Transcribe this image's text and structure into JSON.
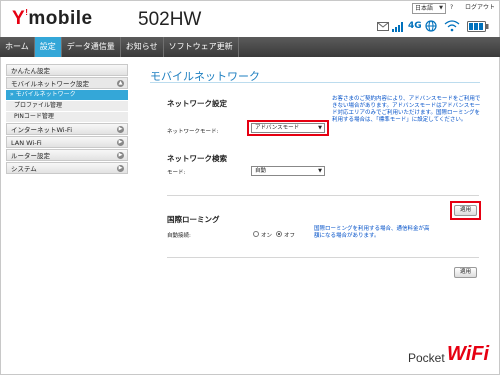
{
  "header": {
    "brand_prefix": "Y",
    "brand_mark": "!",
    "brand_name": "mobile",
    "model": "502HW",
    "language": "日本語",
    "help_label": "?",
    "logout_label": "ログアウト",
    "network_type": "4G",
    "icons": [
      "sms-icon",
      "signal-icon",
      "globe-icon",
      "wifi-status-icon",
      "battery-icon"
    ]
  },
  "nav": [
    {
      "label": "ホーム",
      "active": false
    },
    {
      "label": "設定",
      "active": true
    },
    {
      "label": "データ通信量",
      "active": false
    },
    {
      "label": "お知らせ",
      "active": false
    },
    {
      "label": "ソフトウェア更新",
      "active": false
    }
  ],
  "sidebar": {
    "quick_setup": "かんたん設定",
    "mobile_network_settings": "モバイルネットワーク設定",
    "sub_items": [
      "» モバイルネットワーク",
      "プロファイル管理",
      "PINコード管理"
    ],
    "internet_wifi": "インターネットWi-Fi",
    "lan_wifi": "LAN Wi-Fi",
    "router_settings": "ルーター設定",
    "system": "システム"
  },
  "content": {
    "title": "モバイルネットワーク",
    "network_settings": {
      "heading": "ネットワーク設定",
      "mode_label": "ネットワークモード:",
      "mode_value": "アドバンスモード",
      "note": "お客さまのご契約内容により、アドバンスモードをご利用できない場合があります。アドバンスモードはアドバンスモード対応エリアのみでご利用いただけます。国際ローミングを利用する場合は、「標準モード」に設定してください。"
    },
    "network_search": {
      "heading": "ネットワーク検索",
      "mode_label": "モード:",
      "mode_value": "自動"
    },
    "apply_label": "適用",
    "roaming": {
      "heading": "国際ローミング",
      "auto_connect_label": "自動接続:",
      "on_label": "オン",
      "off_label": "オフ",
      "selected": "off",
      "note": "国際ローミングを利用する場合、通信料金が高額になる場合があります。"
    },
    "apply_label_2": "適用"
  },
  "footer": {
    "logo_text_1": "Pocket",
    "logo_text_2": "WiFi"
  },
  "colors": {
    "accent_blue": "#34a7d8",
    "title_blue": "#1e7fc0",
    "note_blue": "#0050c8",
    "highlight_red": "#e60012",
    "navbar": "#3a3a3a"
  }
}
